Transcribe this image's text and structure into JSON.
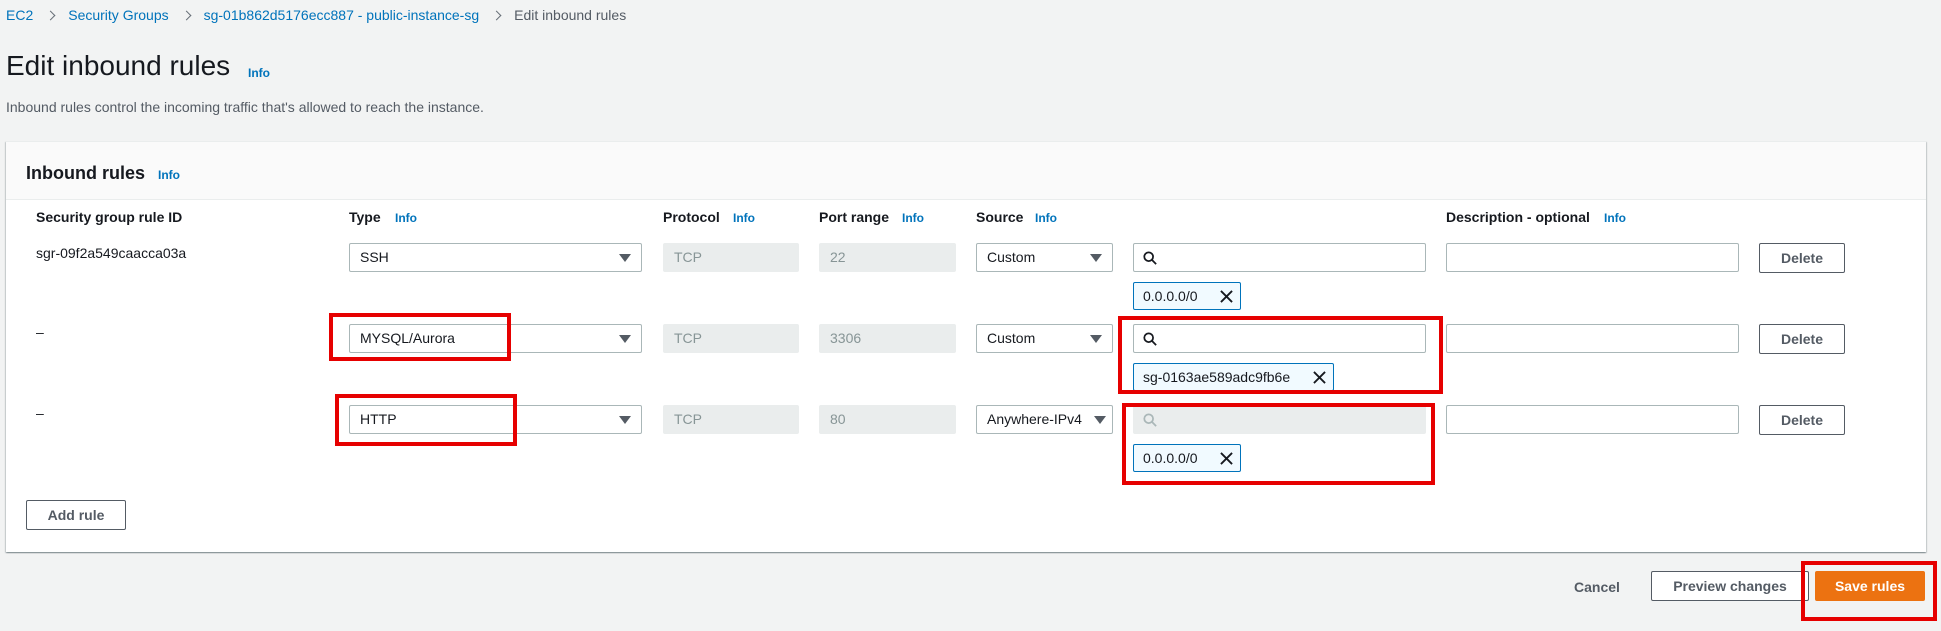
{
  "breadcrumb": {
    "items": [
      "EC2",
      "Security Groups",
      "sg-01b862d5176ecc887 - public-instance-sg"
    ],
    "current": "Edit inbound rules"
  },
  "page": {
    "title": "Edit inbound rules",
    "info": "Info",
    "description": "Inbound rules control the incoming traffic that's allowed to reach the instance."
  },
  "panel": {
    "title": "Inbound rules",
    "info": "Info",
    "columns": {
      "rule_id": "Security group rule ID",
      "type": "Type",
      "protocol": "Protocol",
      "port_range": "Port range",
      "source": "Source",
      "description": "Description - optional",
      "info": "Info"
    }
  },
  "rules": [
    {
      "id": "sgr-09f2a549caacca03a",
      "type": "SSH",
      "protocol": "TCP",
      "port": "22",
      "source": "Custom",
      "search": "",
      "token": "0.0.0.0/0",
      "description": "",
      "delete": "Delete"
    },
    {
      "id": "–",
      "type": "MYSQL/Aurora",
      "protocol": "TCP",
      "port": "3306",
      "source": "Custom",
      "search": "",
      "token": "sg-0163ae589adc9fb6e",
      "description": "",
      "delete": "Delete"
    },
    {
      "id": "–",
      "type": "HTTP",
      "protocol": "TCP",
      "port": "80",
      "source": "Anywhere-IPv4",
      "search": "",
      "token": "0.0.0.0/0",
      "description": "",
      "delete": "Delete"
    }
  ],
  "actions": {
    "add_rule": "Add rule",
    "cancel": "Cancel",
    "preview": "Preview changes",
    "save": "Save rules"
  },
  "icons": [
    "chevron-right-icon",
    "search-icon",
    "close-icon",
    "caret-down-icon"
  ],
  "colors": {
    "link": "#0073bb",
    "primary": "#ec7211",
    "highlight": "#e60000"
  }
}
